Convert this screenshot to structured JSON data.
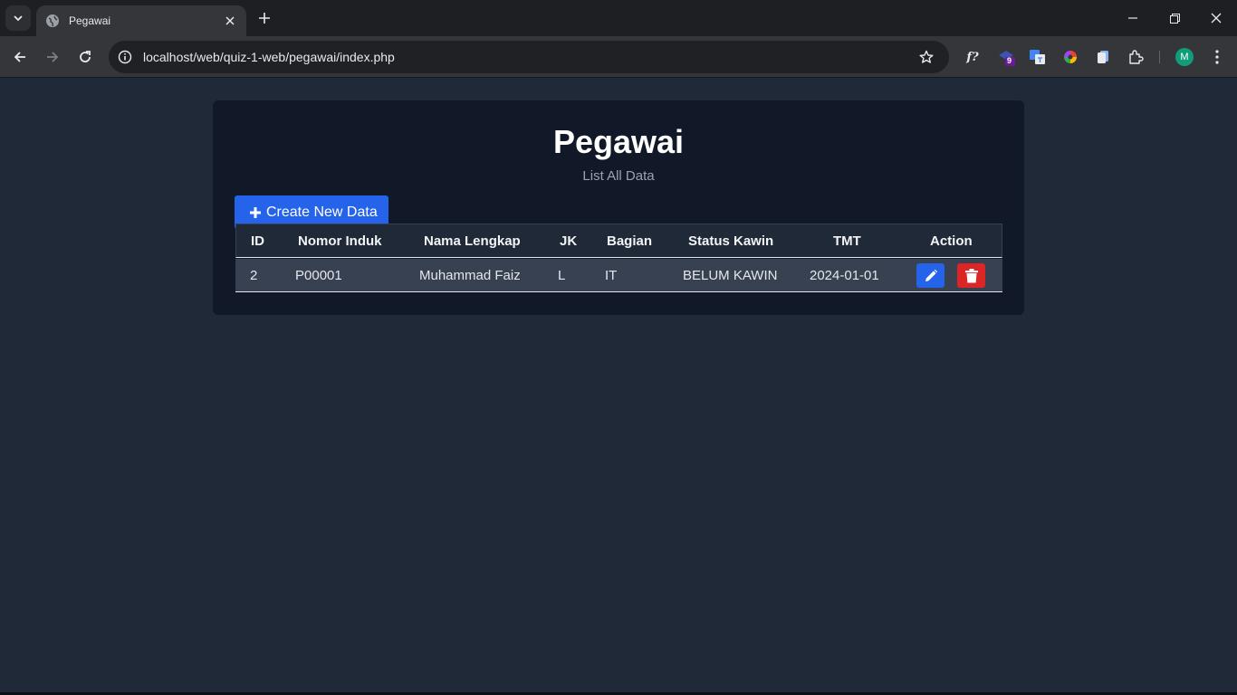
{
  "browser": {
    "tab_title": "Pegawai",
    "url": "localhost/web/quiz-1-web/pegawai/index.php",
    "extensions_badge": "9",
    "avatar_letter": "M",
    "font_ext_label": "f?"
  },
  "page": {
    "title": "Pegawai",
    "subtitle": "List All Data",
    "create_button_label": "Create New Data"
  },
  "table": {
    "headers": [
      "ID",
      "Nomor Induk",
      "Nama Lengkap",
      "JK",
      "Bagian",
      "Status Kawin",
      "TMT",
      "Action"
    ],
    "rows": [
      {
        "id": "2",
        "nomor_induk": "P00001",
        "nama_lengkap": "Muhammad Faiz",
        "jk": "L",
        "bagian": "IT",
        "status_kawin": "BELUM KAWIN",
        "tmt": "2024-01-01"
      }
    ]
  },
  "colors": {
    "page_bg": "#1f2937",
    "card_bg": "#111827",
    "primary": "#2563eb",
    "danger": "#dc2626"
  },
  "icons": {
    "create": "plus-icon",
    "edit": "pencil-icon",
    "delete": "trash-icon"
  }
}
